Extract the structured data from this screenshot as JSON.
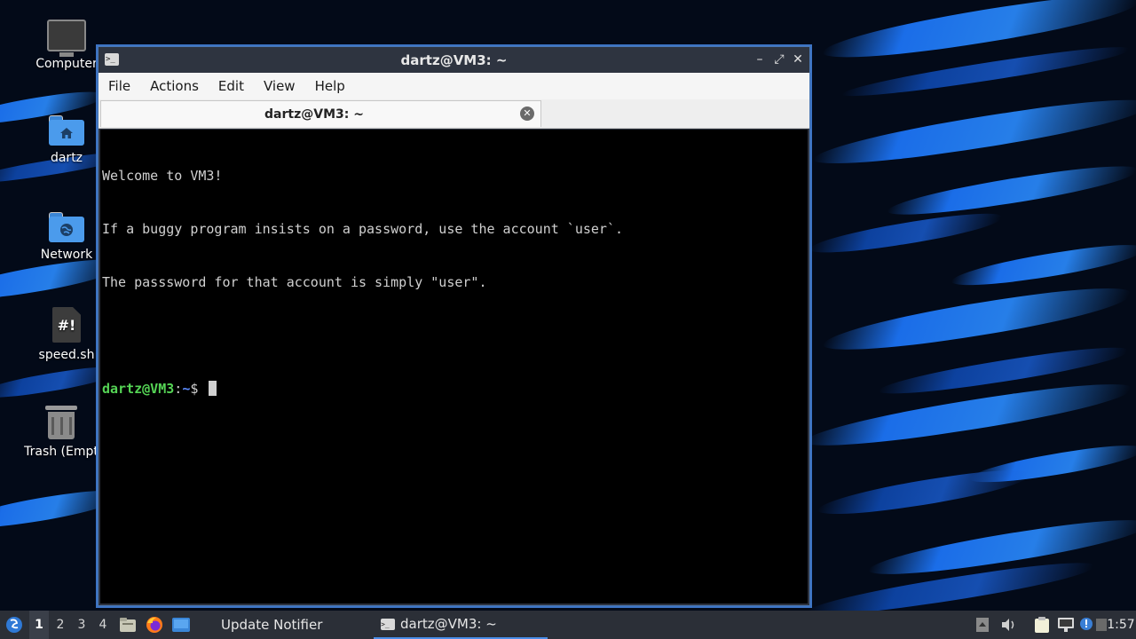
{
  "desktop": {
    "icons": [
      {
        "label": "Computer",
        "icon": "computer-icon"
      },
      {
        "label": "dartz",
        "icon": "home-folder-icon"
      },
      {
        "label": "Network",
        "icon": "network-folder-icon"
      },
      {
        "label": "speed.sh",
        "icon": "script-file-icon",
        "glyph": "#!"
      },
      {
        "label": "Trash (Empt",
        "icon": "trash-icon"
      }
    ]
  },
  "window": {
    "title": "dartz@VM3: ~",
    "app_icon_glyph": ">_",
    "controls": {
      "minimize": "–",
      "maximize": "⤢",
      "close": "✕"
    },
    "menu": [
      "File",
      "Actions",
      "Edit",
      "View",
      "Help"
    ],
    "tab": {
      "label": "dartz@VM3: ~",
      "close_glyph": "✕"
    }
  },
  "terminal": {
    "lines": [
      "Welcome to VM3!",
      "If a buggy program insists on a password, use the account `user`.",
      "The passsword for that account is simply \"user\".",
      ""
    ],
    "prompt": {
      "user_host": "dartz@VM3",
      "sep": ":",
      "path": "~",
      "symbol": "$ "
    }
  },
  "taskbar": {
    "start_icon": "lxqt-menu-icon",
    "workspaces": [
      "1",
      "2",
      "3",
      "4"
    ],
    "active_workspace": "1",
    "quicklaunch": [
      "file-manager-icon",
      "firefox-icon",
      "show-desktop-icon"
    ],
    "tasks": [
      {
        "label": "Update Notifier",
        "active": false
      },
      {
        "label": "dartz@VM3: ~",
        "active": true
      }
    ],
    "tray": [
      "up-arrow-icon",
      "volume-icon",
      "clipboard-icon",
      "network-icon",
      "update-notifier-icon",
      "desktop-icon"
    ],
    "clock": "1:57"
  }
}
